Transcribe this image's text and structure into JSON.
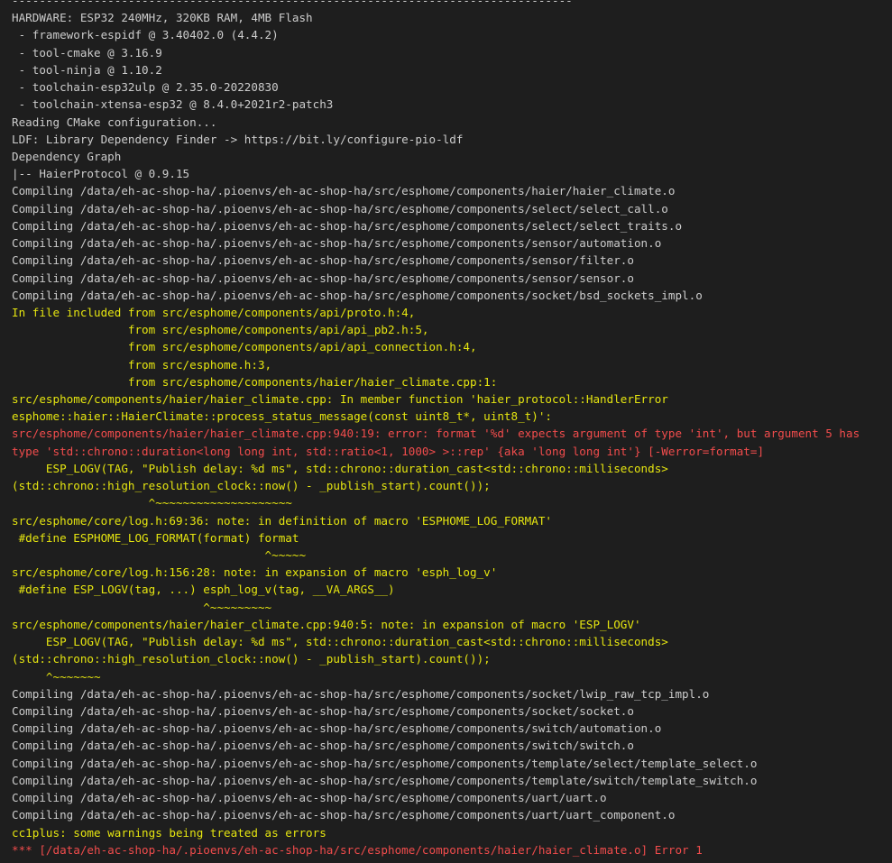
{
  "colors": {
    "background": "#1e1e1e",
    "white": "#cccccc",
    "yellow": "#e5e510",
    "red": "#f14c4c"
  },
  "terminal": {
    "lines": [
      {
        "c": "white",
        "t": "----------------------------------------------------------------------------------"
      },
      {
        "c": "white",
        "t": "HARDWARE: ESP32 240MHz, 320KB RAM, 4MB Flash"
      },
      {
        "c": "white",
        "t": " - framework-espidf @ 3.40402.0 (4.4.2)"
      },
      {
        "c": "white",
        "t": " - tool-cmake @ 3.16.9"
      },
      {
        "c": "white",
        "t": " - tool-ninja @ 1.10.2"
      },
      {
        "c": "white",
        "t": " - toolchain-esp32ulp @ 2.35.0-20220830"
      },
      {
        "c": "white",
        "t": " - toolchain-xtensa-esp32 @ 8.4.0+2021r2-patch3"
      },
      {
        "c": "white",
        "t": "Reading CMake configuration..."
      },
      {
        "c": "white",
        "t": "LDF: Library Dependency Finder -> https://bit.ly/configure-pio-ldf"
      },
      {
        "c": "white",
        "t": "Dependency Graph"
      },
      {
        "c": "white",
        "t": "|-- HaierProtocol @ 0.9.15"
      },
      {
        "c": "white",
        "t": "Compiling /data/eh-ac-shop-ha/.pioenvs/eh-ac-shop-ha/src/esphome/components/haier/haier_climate.o"
      },
      {
        "c": "white",
        "t": "Compiling /data/eh-ac-shop-ha/.pioenvs/eh-ac-shop-ha/src/esphome/components/select/select_call.o"
      },
      {
        "c": "white",
        "t": "Compiling /data/eh-ac-shop-ha/.pioenvs/eh-ac-shop-ha/src/esphome/components/select/select_traits.o"
      },
      {
        "c": "white",
        "t": "Compiling /data/eh-ac-shop-ha/.pioenvs/eh-ac-shop-ha/src/esphome/components/sensor/automation.o"
      },
      {
        "c": "white",
        "t": "Compiling /data/eh-ac-shop-ha/.pioenvs/eh-ac-shop-ha/src/esphome/components/sensor/filter.o"
      },
      {
        "c": "white",
        "t": "Compiling /data/eh-ac-shop-ha/.pioenvs/eh-ac-shop-ha/src/esphome/components/sensor/sensor.o"
      },
      {
        "c": "white",
        "t": "Compiling /data/eh-ac-shop-ha/.pioenvs/eh-ac-shop-ha/src/esphome/components/socket/bsd_sockets_impl.o"
      },
      {
        "c": "yellow",
        "t": "In file included from src/esphome/components/api/proto.h:4,"
      },
      {
        "c": "yellow",
        "t": "                 from src/esphome/components/api/api_pb2.h:5,"
      },
      {
        "c": "yellow",
        "t": "                 from src/esphome/components/api/api_connection.h:4,"
      },
      {
        "c": "yellow",
        "t": "                 from src/esphome.h:3,"
      },
      {
        "c": "yellow",
        "t": "                 from src/esphome/components/haier/haier_climate.cpp:1:"
      },
      {
        "c": "yellow",
        "t": "src/esphome/components/haier/haier_climate.cpp: In member function 'haier_protocol::HandlerError"
      },
      {
        "c": "yellow",
        "t": "esphome::haier::HaierClimate::process_status_message(const uint8_t*, uint8_t)':"
      },
      {
        "c": "red",
        "t": "src/esphome/components/haier/haier_climate.cpp:940:19: error: format '%d' expects argument of type 'int', but argument 5 has"
      },
      {
        "c": "red",
        "t": "type 'std::chrono::duration<long long int, std::ratio<1, 1000> >::rep' {aka 'long long int'} [-Werror=format=]"
      },
      {
        "c": "yellow",
        "t": "     ESP_LOGV(TAG, \"Publish delay: %d ms\", std::chrono::duration_cast<std::chrono::milliseconds>"
      },
      {
        "c": "yellow",
        "t": "(std::chrono::high_resolution_clock::now() - _publish_start).count());"
      },
      {
        "c": "yellow",
        "t": "                    ^~~~~~~~~~~~~~~~~~~~~"
      },
      {
        "c": "yellow",
        "t": "src/esphome/core/log.h:69:36: note: in definition of macro 'ESPHOME_LOG_FORMAT'"
      },
      {
        "c": "yellow",
        "t": " #define ESPHOME_LOG_FORMAT(format) format"
      },
      {
        "c": "yellow",
        "t": "                                     ^~~~~~"
      },
      {
        "c": "yellow",
        "t": "src/esphome/core/log.h:156:28: note: in expansion of macro 'esph_log_v'"
      },
      {
        "c": "yellow",
        "t": " #define ESP_LOGV(tag, ...) esph_log_v(tag, __VA_ARGS__)"
      },
      {
        "c": "yellow",
        "t": "                            ^~~~~~~~~~"
      },
      {
        "c": "yellow",
        "t": "src/esphome/components/haier/haier_climate.cpp:940:5: note: in expansion of macro 'ESP_LOGV'"
      },
      {
        "c": "yellow",
        "t": "     ESP_LOGV(TAG, \"Publish delay: %d ms\", std::chrono::duration_cast<std::chrono::milliseconds>"
      },
      {
        "c": "yellow",
        "t": "(std::chrono::high_resolution_clock::now() - _publish_start).count());"
      },
      {
        "c": "yellow",
        "t": "     ^~~~~~~~"
      },
      {
        "c": "white",
        "t": "Compiling /data/eh-ac-shop-ha/.pioenvs/eh-ac-shop-ha/src/esphome/components/socket/lwip_raw_tcp_impl.o"
      },
      {
        "c": "white",
        "t": "Compiling /data/eh-ac-shop-ha/.pioenvs/eh-ac-shop-ha/src/esphome/components/socket/socket.o"
      },
      {
        "c": "white",
        "t": "Compiling /data/eh-ac-shop-ha/.pioenvs/eh-ac-shop-ha/src/esphome/components/switch/automation.o"
      },
      {
        "c": "white",
        "t": "Compiling /data/eh-ac-shop-ha/.pioenvs/eh-ac-shop-ha/src/esphome/components/switch/switch.o"
      },
      {
        "c": "white",
        "t": "Compiling /data/eh-ac-shop-ha/.pioenvs/eh-ac-shop-ha/src/esphome/components/template/select/template_select.o"
      },
      {
        "c": "white",
        "t": "Compiling /data/eh-ac-shop-ha/.pioenvs/eh-ac-shop-ha/src/esphome/components/template/switch/template_switch.o"
      },
      {
        "c": "white",
        "t": "Compiling /data/eh-ac-shop-ha/.pioenvs/eh-ac-shop-ha/src/esphome/components/uart/uart.o"
      },
      {
        "c": "white",
        "t": "Compiling /data/eh-ac-shop-ha/.pioenvs/eh-ac-shop-ha/src/esphome/components/uart/uart_component.o"
      },
      {
        "c": "yellow",
        "t": "cc1plus: some warnings being treated as errors"
      },
      {
        "c": "red",
        "t": "*** [/data/eh-ac-shop-ha/.pioenvs/eh-ac-shop-ha/src/esphome/components/haier/haier_climate.o] Error 1"
      }
    ]
  }
}
